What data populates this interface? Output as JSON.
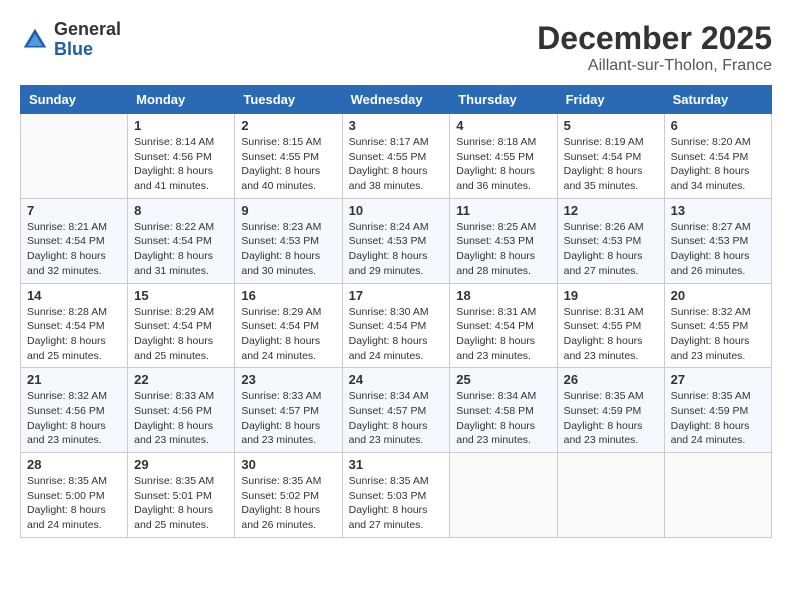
{
  "header": {
    "logo_general": "General",
    "logo_blue": "Blue",
    "month_year": "December 2025",
    "location": "Aillant-sur-Tholon, France"
  },
  "days_of_week": [
    "Sunday",
    "Monday",
    "Tuesday",
    "Wednesday",
    "Thursday",
    "Friday",
    "Saturday"
  ],
  "weeks": [
    [
      {
        "day": "",
        "info": ""
      },
      {
        "day": "1",
        "info": "Sunrise: 8:14 AM\nSunset: 4:56 PM\nDaylight: 8 hours\nand 41 minutes."
      },
      {
        "day": "2",
        "info": "Sunrise: 8:15 AM\nSunset: 4:55 PM\nDaylight: 8 hours\nand 40 minutes."
      },
      {
        "day": "3",
        "info": "Sunrise: 8:17 AM\nSunset: 4:55 PM\nDaylight: 8 hours\nand 38 minutes."
      },
      {
        "day": "4",
        "info": "Sunrise: 8:18 AM\nSunset: 4:55 PM\nDaylight: 8 hours\nand 36 minutes."
      },
      {
        "day": "5",
        "info": "Sunrise: 8:19 AM\nSunset: 4:54 PM\nDaylight: 8 hours\nand 35 minutes."
      },
      {
        "day": "6",
        "info": "Sunrise: 8:20 AM\nSunset: 4:54 PM\nDaylight: 8 hours\nand 34 minutes."
      }
    ],
    [
      {
        "day": "7",
        "info": "Sunrise: 8:21 AM\nSunset: 4:54 PM\nDaylight: 8 hours\nand 32 minutes."
      },
      {
        "day": "8",
        "info": "Sunrise: 8:22 AM\nSunset: 4:54 PM\nDaylight: 8 hours\nand 31 minutes."
      },
      {
        "day": "9",
        "info": "Sunrise: 8:23 AM\nSunset: 4:53 PM\nDaylight: 8 hours\nand 30 minutes."
      },
      {
        "day": "10",
        "info": "Sunrise: 8:24 AM\nSunset: 4:53 PM\nDaylight: 8 hours\nand 29 minutes."
      },
      {
        "day": "11",
        "info": "Sunrise: 8:25 AM\nSunset: 4:53 PM\nDaylight: 8 hours\nand 28 minutes."
      },
      {
        "day": "12",
        "info": "Sunrise: 8:26 AM\nSunset: 4:53 PM\nDaylight: 8 hours\nand 27 minutes."
      },
      {
        "day": "13",
        "info": "Sunrise: 8:27 AM\nSunset: 4:53 PM\nDaylight: 8 hours\nand 26 minutes."
      }
    ],
    [
      {
        "day": "14",
        "info": "Sunrise: 8:28 AM\nSunset: 4:54 PM\nDaylight: 8 hours\nand 25 minutes."
      },
      {
        "day": "15",
        "info": "Sunrise: 8:29 AM\nSunset: 4:54 PM\nDaylight: 8 hours\nand 25 minutes."
      },
      {
        "day": "16",
        "info": "Sunrise: 8:29 AM\nSunset: 4:54 PM\nDaylight: 8 hours\nand 24 minutes."
      },
      {
        "day": "17",
        "info": "Sunrise: 8:30 AM\nSunset: 4:54 PM\nDaylight: 8 hours\nand 24 minutes."
      },
      {
        "day": "18",
        "info": "Sunrise: 8:31 AM\nSunset: 4:54 PM\nDaylight: 8 hours\nand 23 minutes."
      },
      {
        "day": "19",
        "info": "Sunrise: 8:31 AM\nSunset: 4:55 PM\nDaylight: 8 hours\nand 23 minutes."
      },
      {
        "day": "20",
        "info": "Sunrise: 8:32 AM\nSunset: 4:55 PM\nDaylight: 8 hours\nand 23 minutes."
      }
    ],
    [
      {
        "day": "21",
        "info": "Sunrise: 8:32 AM\nSunset: 4:56 PM\nDaylight: 8 hours\nand 23 minutes."
      },
      {
        "day": "22",
        "info": "Sunrise: 8:33 AM\nSunset: 4:56 PM\nDaylight: 8 hours\nand 23 minutes."
      },
      {
        "day": "23",
        "info": "Sunrise: 8:33 AM\nSunset: 4:57 PM\nDaylight: 8 hours\nand 23 minutes."
      },
      {
        "day": "24",
        "info": "Sunrise: 8:34 AM\nSunset: 4:57 PM\nDaylight: 8 hours\nand 23 minutes."
      },
      {
        "day": "25",
        "info": "Sunrise: 8:34 AM\nSunset: 4:58 PM\nDaylight: 8 hours\nand 23 minutes."
      },
      {
        "day": "26",
        "info": "Sunrise: 8:35 AM\nSunset: 4:59 PM\nDaylight: 8 hours\nand 23 minutes."
      },
      {
        "day": "27",
        "info": "Sunrise: 8:35 AM\nSunset: 4:59 PM\nDaylight: 8 hours\nand 24 minutes."
      }
    ],
    [
      {
        "day": "28",
        "info": "Sunrise: 8:35 AM\nSunset: 5:00 PM\nDaylight: 8 hours\nand 24 minutes."
      },
      {
        "day": "29",
        "info": "Sunrise: 8:35 AM\nSunset: 5:01 PM\nDaylight: 8 hours\nand 25 minutes."
      },
      {
        "day": "30",
        "info": "Sunrise: 8:35 AM\nSunset: 5:02 PM\nDaylight: 8 hours\nand 26 minutes."
      },
      {
        "day": "31",
        "info": "Sunrise: 8:35 AM\nSunset: 5:03 PM\nDaylight: 8 hours\nand 27 minutes."
      },
      {
        "day": "",
        "info": ""
      },
      {
        "day": "",
        "info": ""
      },
      {
        "day": "",
        "info": ""
      }
    ]
  ]
}
